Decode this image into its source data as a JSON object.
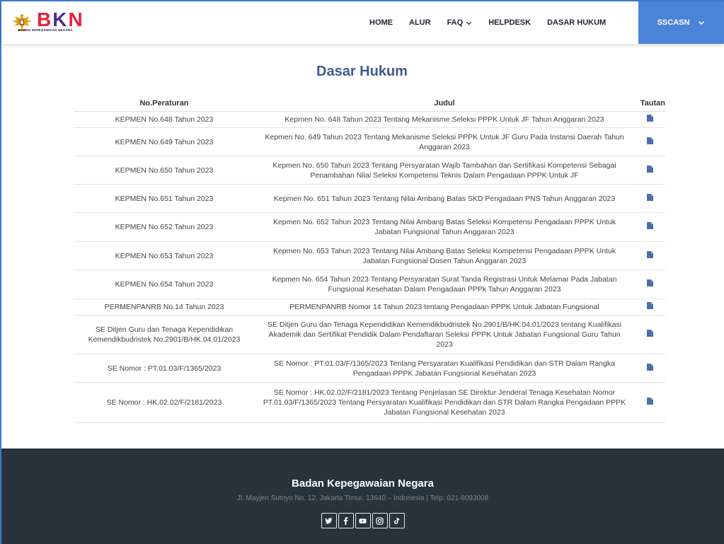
{
  "brand": {
    "letters": [
      "B",
      "K",
      "N"
    ],
    "subtitle": "BADAN KEPEGAWAIAN NEGARA"
  },
  "nav": {
    "items": [
      "HOME",
      "ALUR",
      "FAQ",
      "HELPDESK",
      "DASAR HUKUM"
    ],
    "account_label": "SSCASN"
  },
  "page": {
    "title": "Dasar Hukum"
  },
  "table": {
    "headers": [
      "No.Peraturan",
      "Judul",
      "Tautan"
    ],
    "rows": [
      {
        "no": "KEPMEN No.648 Tahun 2023",
        "judul": "Kepmen No. 648 Tahun 2023 Tentang Mekanisme Seleksi PPPK Untuk JF Tahun Anggaran 2023"
      },
      {
        "no": "KEPMEN No.649 Tahun 2023",
        "judul": "Kepmen No. 649 Tahun 2023 Tentang Mekanisme Seleksi PPPK Untuk JF Guru Pada Instansi Daerah Tahun Anggaran 2023"
      },
      {
        "no": "KEPMEN No.650 Tahun 2023",
        "judul": "Kepmen No. 650 Tahun 2023 Tentang Persyaratan Wajib Tambahan dan Sertifikasi Kompetensi Sebagai Penambahan Nilai Seleksi Kompetensi Teknis Dalam Pengadaan PPPK Untuk JF"
      },
      {
        "no": "KEPMEN No.651 Tahun 2023",
        "judul": "Kepmen No. 651 Tahun 2023 Tentang Nilai Ambang Batas SKD Pengadaan PNS Tahun Anggaran 2023"
      },
      {
        "no": "KEPMEN No.652 Tahun 2023",
        "judul": "Kepmen No. 652 Tahun 2023 Tentang Nilai Ambang Batas Seleksi Kompetensi Pengadaan PPPK Untuk Jabatan Fungsional Tahun Anggaran 2023"
      },
      {
        "no": "KEPMEN No.653 Tahun 2023",
        "judul": "Kepmen No. 653 Tahun 2023 Tentang Nilai Ambang Batas Seleksi Kompetensi Pengadaan PPPK Untuk Jabatan Fungsional Dosen Tahun Anggaran 2023"
      },
      {
        "no": "KEPMEN No.654 Tahun 2023",
        "judul": "Kepmen No. 654 Tahun 2023 Tentang Persyaratan Surat Tanda Registrasi Untuk Melamar Pada Jabatan Fungsional Kesehatan Dalam Pengadaan PPPk Tahun Anggaran 2023"
      },
      {
        "no": "PERMENPANRB No.14 Tahun 2023",
        "judul": "PERMENPANRB Nomor 14 Tahun 2023 tentang Pengadaan PPPK Untuk Jabatan Fungsional"
      },
      {
        "no": "SE Ditjen Guru dan Tenaga Kependidikan Kemendikbudristek No.2901/B/HK.04.01/2023",
        "judul": "SE Ditjen Guru dan Tenaga Kependidikan Kemendikbudristek No.2901/B/HK.04.01/2023 tentang Kualifikasi Akademik dan Sertifikat Pendidik Dalam Pendaftaran Seleksi PPPK Untuk Jabatan Fungsional Guru Tahun 2023"
      },
      {
        "no": "SE Nomor : PT.01.03/F/1365/2023",
        "judul": "SE Nomor : PT.01.03/F/1365/2023 Tentang Persyaratan Kualifikasi Pendidikan dan STR Dalam Rangka Pengadaan PPPK Jabatan Fungsional Kesehatan 2023"
      },
      {
        "no": "SE Nomor : HK.02.02/F/2181/2023",
        "judul": "SE Nomor : HK.02.02/F/2181/2023 Tentang Penjelasan SE Direktur Jenderal Tenaga Kesehatan Nomor PT.01.03/F/1365/2023 Tentang Persyaratan Kualifikasi Pendidikan dan STR Dalam Rangka Pengadaan PPPK Jabatan Fungsional Kesehatan 2023"
      }
    ]
  },
  "footer": {
    "title": "Badan Kepegawaian Negara",
    "address": "Jl. Mayjen Sutoyo No. 12, Jakarta Timur, 13640 – Indonesia | Telp. 021-8093008",
    "socials": [
      "twitter-icon",
      "facebook-icon",
      "youtube-icon",
      "instagram-icon",
      "tiktok-icon"
    ]
  },
  "colors": {
    "accent": "#4a83d7",
    "title": "#3f5b8f",
    "footer_bg": "#28333b",
    "doc_icon": "#4a6fa8",
    "logo_red": "#e5233d",
    "logo_purple": "#4b2d8f"
  }
}
